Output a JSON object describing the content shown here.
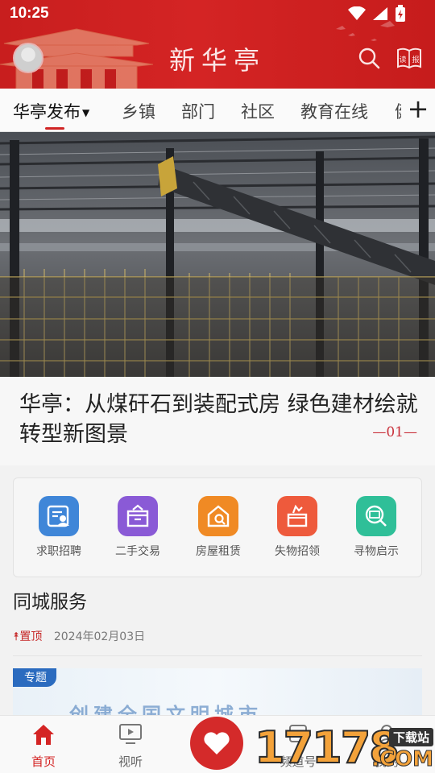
{
  "status_bar": {
    "time": "10:25"
  },
  "header": {
    "app_title": "新华亭",
    "search_icon": "search-icon",
    "newspaper_icon": "newspaper-icon",
    "brand_color": "#d42424"
  },
  "tabs": {
    "items": [
      {
        "label": "华亭发布",
        "active": true
      },
      {
        "label": "乡镇"
      },
      {
        "label": "部门"
      },
      {
        "label": "社区"
      },
      {
        "label": "教育在线"
      },
      {
        "label": "健"
      }
    ],
    "add_icon": "plus-icon"
  },
  "hero": {
    "title": "华亭：从煤矸石到装配式房 绿色建材绘就转型新图景",
    "index": "—01—"
  },
  "services": {
    "items": [
      {
        "label": "求职招聘",
        "icon": "id-card-icon",
        "color": "#3f86d8"
      },
      {
        "label": "二手交易",
        "icon": "box-icon",
        "color": "#8a5ad6"
      },
      {
        "label": "房屋租赁",
        "icon": "house-search-icon",
        "color": "#f08a24"
      },
      {
        "label": "失物招领",
        "icon": "lost-box-icon",
        "color": "#ee5a3c"
      },
      {
        "label": "寻物启示",
        "icon": "magnifier-card-icon",
        "color": "#2fbf98"
      }
    ]
  },
  "feed": {
    "section_title": "同城服务",
    "pin_label": "置顶",
    "date": "2024年02月03日",
    "banner_tag": "专题",
    "banner_text": "创建全国文明城市"
  },
  "bottom_nav": {
    "items": [
      {
        "label": "首页",
        "icon": "home-icon",
        "active": true
      },
      {
        "label": "视听",
        "icon": "tv-icon"
      },
      {
        "label": "",
        "icon": "heart-icon"
      },
      {
        "label": "频道号",
        "icon": "channel-icon"
      },
      {
        "label": "我的",
        "icon": "user-icon"
      }
    ]
  },
  "watermark": {
    "number": "17178",
    "site": "下载站",
    "domain": ".COM"
  }
}
